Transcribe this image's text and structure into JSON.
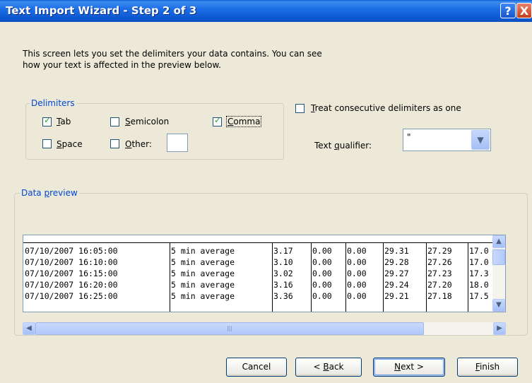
{
  "window": {
    "title": "Text Import Wizard - Step 2 of 3",
    "help_label": "?",
    "close_label": "X"
  },
  "intro": {
    "line1": "This screen lets you set the delimiters your data contains.  You can see",
    "line2": "how your text is affected in the preview below."
  },
  "delimiters": {
    "group_label": "Delimiters",
    "tab": {
      "pre": "",
      "key": "T",
      "post": "ab",
      "checked": true
    },
    "semicolon": {
      "pre": "",
      "key": "S",
      "post": "emicolon",
      "checked": false
    },
    "comma": {
      "pre": "",
      "key": "C",
      "post": "omma",
      "checked": true
    },
    "space": {
      "pre": "",
      "key": "S",
      "post": "pace",
      "checked": false
    },
    "other": {
      "pre": "",
      "key": "O",
      "post": "ther:",
      "checked": false,
      "value": ""
    }
  },
  "consecutive": {
    "pre": "",
    "key": "T",
    "post": "reat consecutive delimiters as one",
    "checked": false
  },
  "qualifier": {
    "pre": "Text ",
    "key": "q",
    "post": "ualifier:",
    "value": "\""
  },
  "preview": {
    "group_pre": "Data ",
    "group_key": "p",
    "group_post": "review",
    "rows": [
      [
        "07/10/2007 16:05:00",
        "5 min average",
        "3.17",
        "0.00",
        "0.00",
        "29.31",
        "27.29",
        "17.0"
      ],
      [
        "07/10/2007 16:10:00",
        "5 min average",
        "3.10",
        "0.00",
        "0.00",
        "29.28",
        "27.26",
        "17.0"
      ],
      [
        "07/10/2007 16:15:00",
        "5 min average",
        "3.02",
        "0.00",
        "0.00",
        "29.27",
        "27.23",
        "17.3"
      ],
      [
        "07/10/2007 16:20:00",
        "5 min average",
        "3.16",
        "0.00",
        "0.00",
        "29.24",
        "27.20",
        "18.0"
      ],
      [
        "07/10/2007 16:25:00",
        "5 min average",
        "3.36",
        "0.00",
        "0.00",
        "29.21",
        "27.18",
        "17.5"
      ]
    ]
  },
  "scrollbar_icons": {
    "up": "up-arrow-icon",
    "down": "down-arrow-icon",
    "left": "left-arrow-icon",
    "right": "right-arrow-icon"
  },
  "buttons": {
    "cancel": {
      "pre": "Cancel",
      "key": "",
      "post": ""
    },
    "back": {
      "pre": "< ",
      "key": "B",
      "post": "ack"
    },
    "next": {
      "pre": "",
      "key": "N",
      "post": "ext >"
    },
    "finish": {
      "pre": "",
      "key": "F",
      "post": "inish"
    }
  }
}
